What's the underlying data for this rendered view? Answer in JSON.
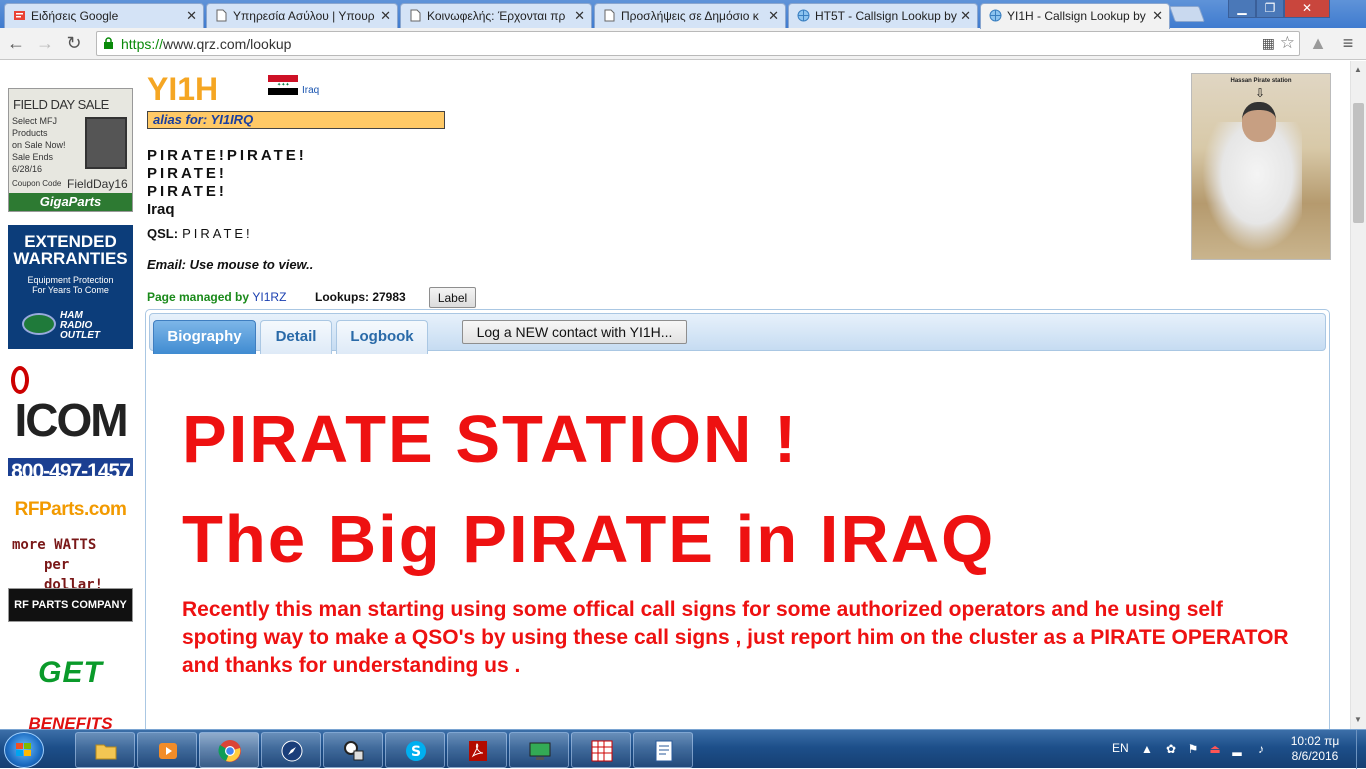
{
  "browser": {
    "tabs": [
      {
        "title": "Ειδήσεις Google",
        "icon": "google-news-icon"
      },
      {
        "title": "Υπηρεσία Ασύλου | Υπουρ",
        "icon": "page-icon"
      },
      {
        "title": "Κοινωφελής: Έρχονται πρ",
        "icon": "page-icon"
      },
      {
        "title": "Προσλήψεις σε Δημόσιο κ",
        "icon": "page-icon"
      },
      {
        "title": "HT5T - Callsign Lookup by",
        "icon": "globe-icon"
      },
      {
        "title": "YI1H - Callsign Lookup by",
        "icon": "globe-icon",
        "active": true
      }
    ],
    "url_scheme": "https://",
    "url_rest": "www.qrz.com/lookup"
  },
  "ads": {
    "fieldday": {
      "title": "FIELD DAY SALE",
      "lines": [
        "Select MFJ",
        "Products",
        "on Sale Now!",
        "Sale Ends",
        "6/28/16"
      ],
      "coupon_label": "Coupon Code",
      "coupon_code": "FieldDay16",
      "brand": "GigaParts"
    },
    "warranty": {
      "line1": "EXTENDED",
      "line2": "WARRANTIES",
      "sub1": "Equipment Protection",
      "sub2": "For Years To Come",
      "brand1": "HAM",
      "brand2": "RADIO",
      "brand3": "OUTLET"
    },
    "icom": {
      "logo": "ICOM",
      "phone": "800-497-1457"
    },
    "rfparts": {
      "site": "RFParts.com",
      "line1": "more WATTS",
      "line2": "per dollar!",
      "badge": "RF PARTS COMPANY"
    },
    "get": {
      "line1": "GET",
      "line2": "BENEFITS"
    }
  },
  "profile": {
    "callsign": "YI1H",
    "country_link": "Iraq",
    "alias": "alias for: YI1IRQ",
    "address_lines": [
      "PIRATE!PIRATE!",
      "PIRATE!",
      "PIRATE!"
    ],
    "country": "Iraq",
    "qsl_label": "QSL:",
    "qsl_value": "PIRATE!",
    "email": "Email: Use mouse to view..",
    "managed_label": "Page managed by",
    "managed_by": "YI1RZ",
    "lookups": "Lookups: 27983",
    "label_button": "Label",
    "photo_caption": "Hassan Pirate station"
  },
  "tabs": {
    "biography": "Biography",
    "detail": "Detail",
    "logbook": "Logbook",
    "log_button": "Log a NEW contact with YI1H..."
  },
  "bio": {
    "heading1": "PIRATE STATION !",
    "heading2": "The Big PIRATE in IRAQ",
    "paragraph": "Recently this man starting using some offical call signs for some authorized operators and he using self spoting way to make a QSO's by using these call signs , just report him on the cluster as a PIRATE OPERATOR and thanks for understanding us ."
  },
  "taskbar": {
    "language": "EN",
    "time": "10:02 πμ",
    "date": "8/6/2016"
  },
  "colors": {
    "callsign": "#f5a623",
    "bio_red": "#ee1111",
    "alias_bg": "#ffc966",
    "tab_active": "#3f8bd1"
  }
}
